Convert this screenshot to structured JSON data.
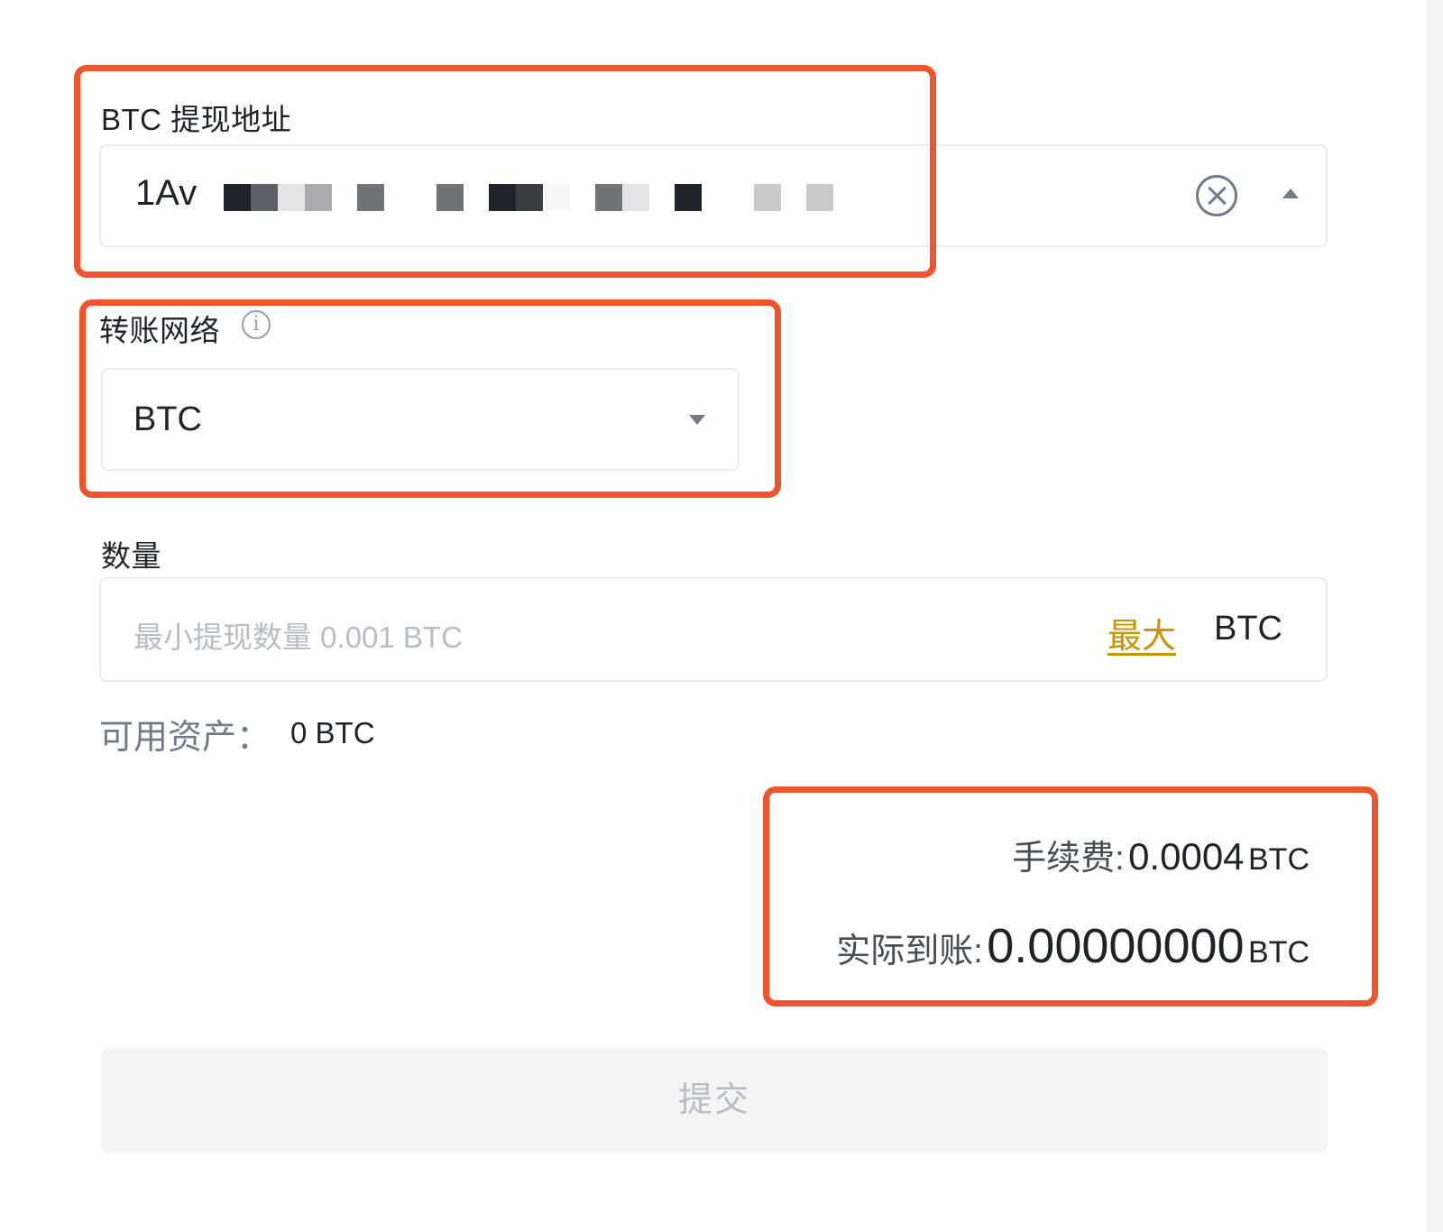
{
  "address_section": {
    "label": "BTC 提现地址",
    "value_prefix": "1Av"
  },
  "network_section": {
    "label": "转账网络",
    "info_icon": "i",
    "selected": "BTC"
  },
  "amount_section": {
    "label": "数量",
    "placeholder": "最小提现数量 0.001 BTC",
    "max_label": "最大",
    "unit": "BTC"
  },
  "available": {
    "label": "可用资产：",
    "value": "0 BTC"
  },
  "fee": {
    "label": "手续费:",
    "value": "0.0004",
    "unit": "BTC"
  },
  "received": {
    "label": "实际到账:",
    "value": "0.00000000",
    "unit": "BTC"
  },
  "submit": {
    "label": "提交"
  },
  "colors": {
    "highlight": "#f0542d",
    "accent": "#c99400",
    "disabled_button": "#f5f5f5"
  }
}
